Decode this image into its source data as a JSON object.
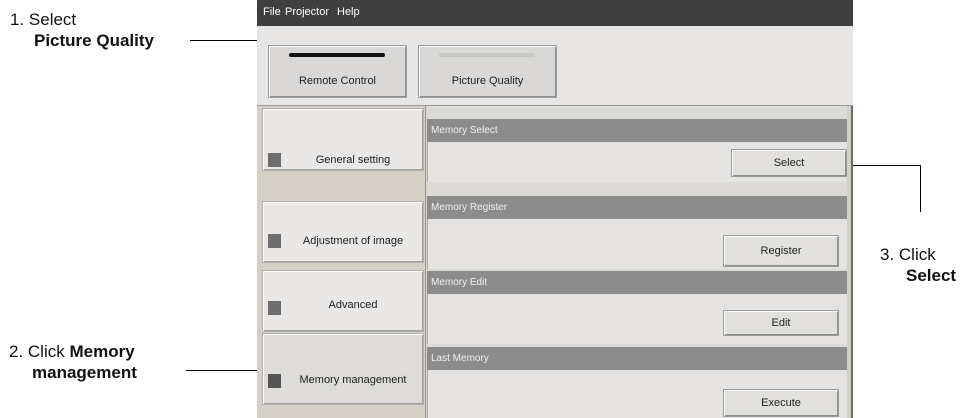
{
  "callouts": {
    "step1": {
      "prefix": "1. Select",
      "bold": "Picture Quality"
    },
    "step2": {
      "prefix": "2. Click ",
      "bold1": "Memory",
      "bold2": "management"
    },
    "step3": {
      "prefix": "3. Click",
      "bold": "Select"
    }
  },
  "menu": [
    "File",
    "Projector",
    "Help"
  ],
  "toolbar": {
    "remote_control": "Remote Control",
    "picture_quality": "Picture Quality"
  },
  "sidebar": {
    "items": [
      {
        "label": "General setting"
      },
      {
        "label": "Adjustment of image"
      },
      {
        "label": "Advanced"
      },
      {
        "label": "Memory management"
      }
    ]
  },
  "panel": {
    "groups": [
      {
        "title": "Memory Select",
        "button": "Select"
      },
      {
        "title": "Memory Register",
        "button": "Register"
      },
      {
        "title": "Memory Edit",
        "button": "Edit"
      },
      {
        "title": "Last Memory",
        "button": "Execute"
      }
    ]
  }
}
